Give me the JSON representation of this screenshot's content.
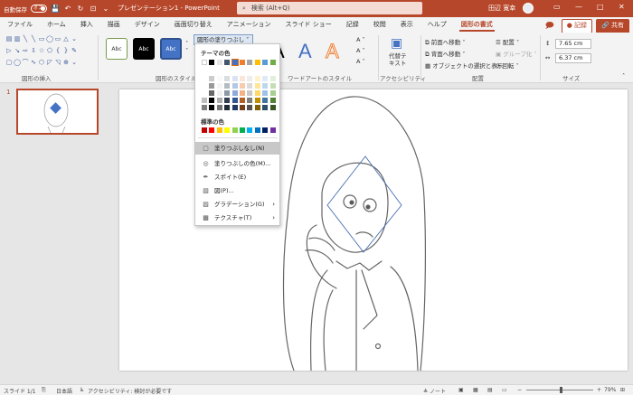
{
  "titlebar": {
    "autosave_label": "自動保存",
    "autosave_state": "オフ",
    "doc_title": "プレゼンテーション1  -  PowerPoint",
    "search_placeholder": "検索 (Alt+Q)",
    "user_name": "田辺 寛幸",
    "minimize": "—",
    "maximize": "□",
    "close": "✕"
  },
  "tabs": [
    "ファイル",
    "ホーム",
    "挿入",
    "描画",
    "デザイン",
    "画面切り替え",
    "アニメーション",
    "スライド ショー",
    "記録",
    "校閲",
    "表示",
    "ヘルプ",
    "図形の書式"
  ],
  "active_tab": "図形の書式",
  "tab_buttons": {
    "record": "● 記録",
    "share": "🔗 共有"
  },
  "ribbon": {
    "groups": {
      "insert_shapes": "図形の挿入",
      "shape_styles": "図形のスタイル",
      "wordart_styles": "ワードアートのスタイル",
      "accessibility": "アクセシビリティ",
      "arrange": "配置",
      "size": "サイズ"
    },
    "style_samples": [
      "Abc",
      "Abc",
      "Abc"
    ],
    "fill_button": "図形の塗りつぶし ˅",
    "wordart_letter": "A",
    "alt_text": "代替テ\nキスト",
    "arrange_items": [
      "前面へ移動 ˅",
      "背面へ移動 ˅",
      "オブジェクトの選択と表示",
      "配置 ˅",
      "グループ化 ˅",
      "回転 ˅"
    ],
    "height": "7.65 cm",
    "width": "6.37 cm"
  },
  "thumbpane": {
    "slide_number": "1"
  },
  "dropdown": {
    "theme_colors_header": "テーマの色",
    "standard_colors_header": "標準の色",
    "items": [
      {
        "label": "塗りつぶしなし(N)",
        "icon": "no-fill-icon"
      },
      {
        "label": "塗りつぶしの色(M)...",
        "icon": "palette-icon"
      },
      {
        "label": "スポイト(E)",
        "icon": "eyedropper-icon"
      },
      {
        "label": "図(P)...",
        "icon": "picture-icon"
      },
      {
        "label": "グラデーション(G)",
        "icon": "gradient-icon"
      },
      {
        "label": "テクスチャ(T)",
        "icon": "texture-icon"
      }
    ],
    "theme_top_row": [
      "#ffffff",
      "#000000",
      "#e7e6e6",
      "#44546a",
      "#4472c4",
      "#ed7d31",
      "#a5a5a5",
      "#ffc000",
      "#5b9bd5",
      "#70ad47"
    ],
    "standard_colors": [
      "#c00000",
      "#ff0000",
      "#ffc000",
      "#ffff00",
      "#92d050",
      "#00b050",
      "#00b0f0",
      "#0070c0",
      "#002060",
      "#7030a0"
    ]
  },
  "statusbar": {
    "slide": "スライド 1/1",
    "language": "日本語",
    "accessibility": "アクセシビリティ: 検討が必要です",
    "notes": "ノート",
    "zoom": "79%"
  }
}
